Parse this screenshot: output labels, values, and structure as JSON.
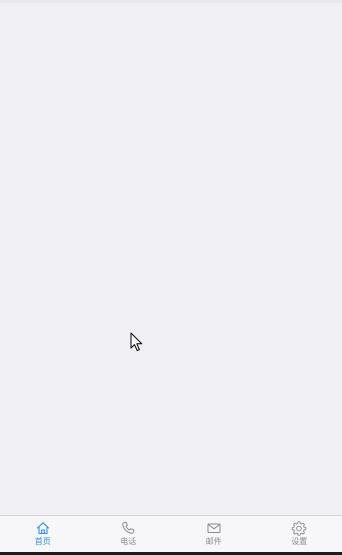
{
  "tabbar": {
    "tabs": [
      {
        "label": "首页",
        "icon": "home-icon",
        "active": true
      },
      {
        "label": "电话",
        "icon": "phone-icon",
        "active": false
      },
      {
        "label": "邮件",
        "icon": "mail-icon",
        "active": false
      },
      {
        "label": "设置",
        "icon": "gear-icon",
        "active": false
      }
    ]
  },
  "colors": {
    "background": "#efeff4",
    "tabbar_background": "#f7f7fa",
    "active": "#2f8ef5",
    "inactive": "#8a8a8f"
  }
}
